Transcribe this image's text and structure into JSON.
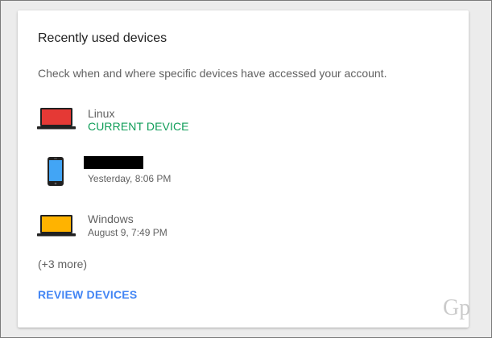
{
  "card": {
    "title": "Recently used devices",
    "description": "Check when and where specific devices have accessed your account."
  },
  "devices": [
    {
      "name": "Linux",
      "status": "CURRENT DEVICE",
      "icon": "laptop-icon",
      "screen_color": "#e53935"
    },
    {
      "name": "",
      "time": "Yesterday, 8:06 PM",
      "icon": "smartphone-icon",
      "screen_color": "#42a5f5"
    },
    {
      "name": "Windows",
      "time": "August 9, 7:49 PM",
      "icon": "laptop-icon",
      "screen_color": "#ffb300"
    }
  ],
  "more": "(+3 more)",
  "review_label": "REVIEW DEVICES",
  "watermark": "Gp",
  "colors": {
    "accent": "#4285f4",
    "current_device": "#0f9d58"
  }
}
